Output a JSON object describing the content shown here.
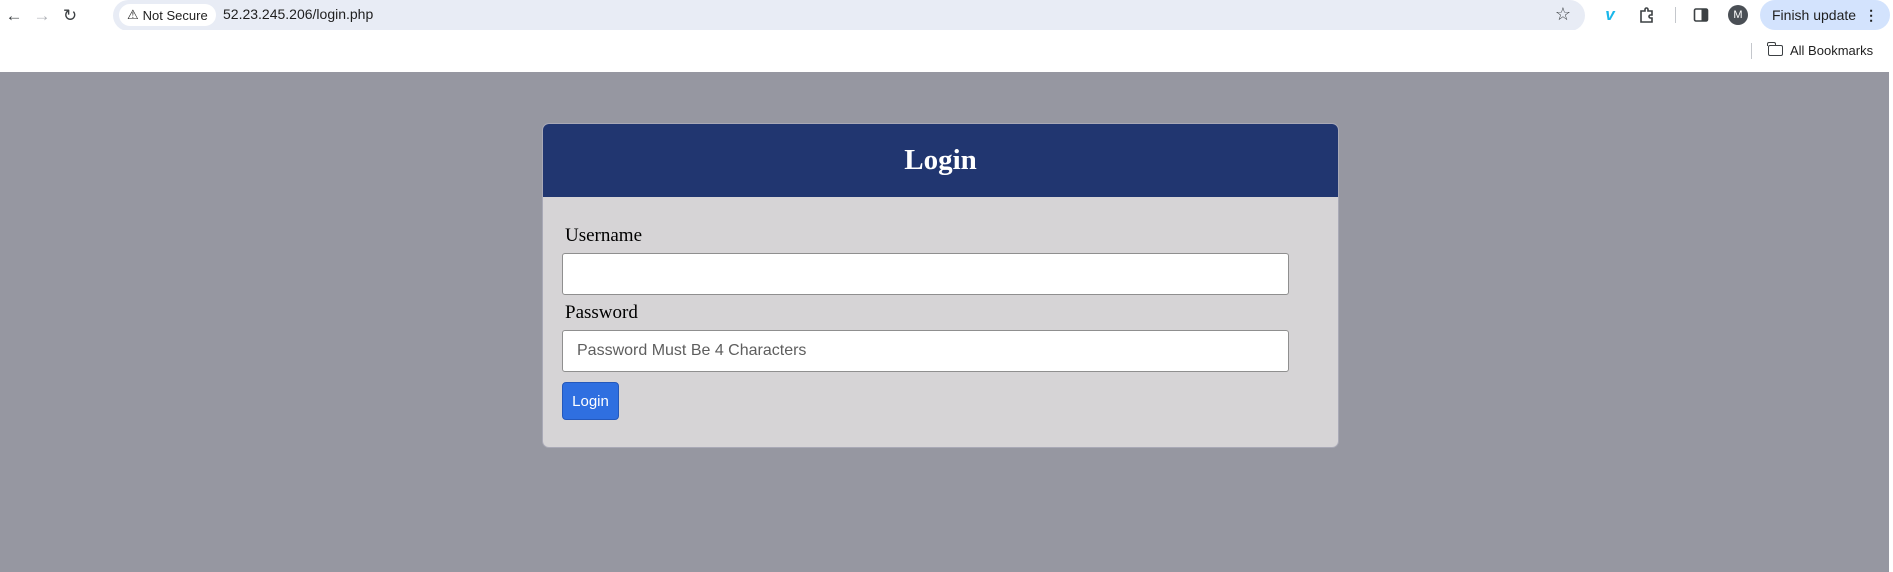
{
  "browser": {
    "security_label": "Not Secure",
    "url": "52.23.245.206/login.php",
    "profile_initial": "M",
    "finish_update_label": "Finish update",
    "bookmarks_label": "All Bookmarks"
  },
  "login": {
    "title": "Login",
    "username_label": "Username",
    "username_value": "",
    "password_label": "Password",
    "password_placeholder": "Password Must Be 4 Characters",
    "submit_label": "Login"
  },
  "colors": {
    "page_background": "#9697a1",
    "card_background": "#d6d4d6",
    "header_background": "#213670",
    "button_background": "#2f6fe0"
  }
}
